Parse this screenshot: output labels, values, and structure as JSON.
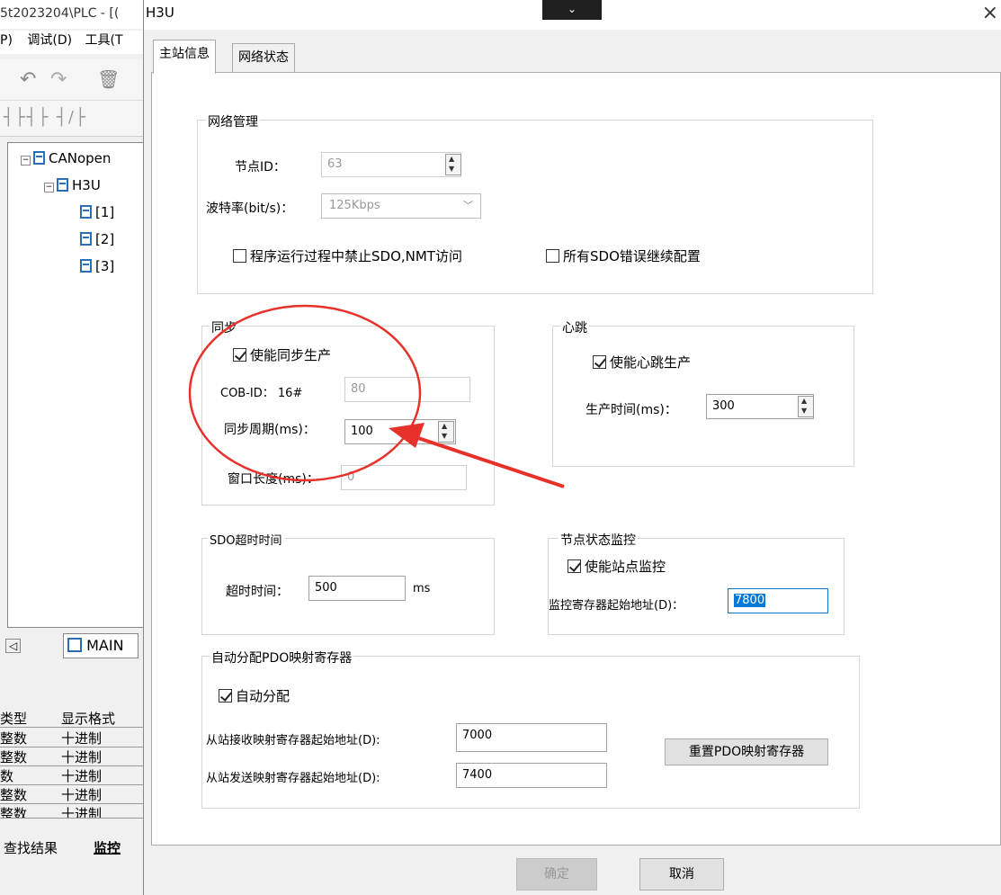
{
  "background_app": {
    "title_fragment": "5t2023204\\PLC - [(",
    "menu": [
      "P) ",
      "调试(D)",
      "工具(T"
    ],
    "tree": [
      "CANopen",
      "H3U",
      "[1]",
      "[2]",
      "[3]"
    ],
    "tab_main": "MAIN",
    "grid_header": [
      "类型",
      "显示格式"
    ],
    "grid_rows": [
      [
        "整数",
        "十进制"
      ],
      [
        "整数",
        "十进制"
      ],
      [
        "数",
        "十进制"
      ],
      [
        "整数",
        "十进制"
      ],
      [
        "整数",
        "十进制"
      ]
    ],
    "bottom_tabs": [
      "查找结果",
      "监控"
    ]
  },
  "dialog": {
    "title": "H3U",
    "chevron": "⌄",
    "close": "×",
    "tabs": [
      "主站信息",
      "网络状态"
    ],
    "network": {
      "title": "网络管理",
      "node_id_label": "节点ID：",
      "node_id": "63",
      "baud_label": "波特率(bit/s)：",
      "baud": "125Kbps",
      "chk_disable_sdo": "程序运行过程中禁止SDO,NMT访问",
      "chk_continue": "所有SDO错误继续配置"
    },
    "sync": {
      "title": "同步",
      "enable": "使能同步生产",
      "cobid_label": "COB-ID：  16#",
      "cobid": "80",
      "period_label": "同步周期(ms)：",
      "period": "100",
      "window_label": "窗口长度(ms)：",
      "window": "0"
    },
    "heartbeat": {
      "title": "心跳",
      "enable": "使能心跳生产",
      "time_label": "生产时间(ms)：",
      "time": "300"
    },
    "sdo": {
      "title": "SDO超时时间",
      "timeout_label": "超时时间：",
      "timeout": "500",
      "unit": "ms"
    },
    "node_monitor": {
      "title": "节点状态监控",
      "enable": "使能站点监控",
      "addr_label": "监控寄存器起始地址(D)：",
      "addr": "7800"
    },
    "pdo": {
      "title": "自动分配PDO映射寄存器",
      "auto": "自动分配",
      "rx_label": "从站接收映射寄存器起始地址(D):",
      "rx": "7000",
      "tx_label": "从站发送映射寄存器起始地址(D):",
      "tx": "7400",
      "reset_btn": "重置PDO映射寄存器"
    },
    "ok": "确定",
    "cancel": "取消"
  },
  "annotation_color": "#e8312a"
}
